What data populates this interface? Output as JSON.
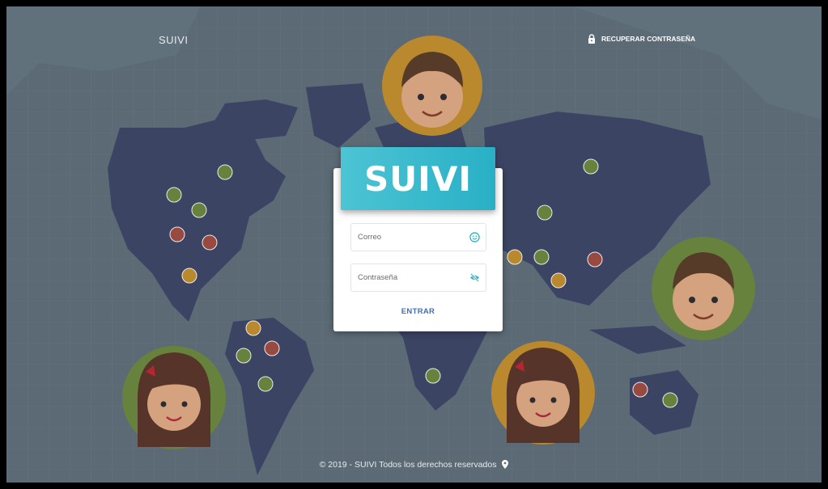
{
  "header": {
    "brand": "SUIVI",
    "recover_label": "RECUPERAR CONTRASEÑA"
  },
  "login": {
    "logo_text": "SUIVI",
    "email_placeholder": "Correo",
    "password_placeholder": "Contraseña",
    "submit_label": "ENTRAR"
  },
  "footer": {
    "text": "© 2019 - SUIVI Todos los derechos reservados"
  },
  "icons": {
    "lock": "lock-icon",
    "email": "smiley-icon",
    "password": "eye-off-icon",
    "footer": "map-pin-icon"
  },
  "colors": {
    "accent": "#3f6fb6",
    "logo_bg": "#29b0c6",
    "continent": "#3b4466",
    "ocean": "#5f6f7a"
  }
}
